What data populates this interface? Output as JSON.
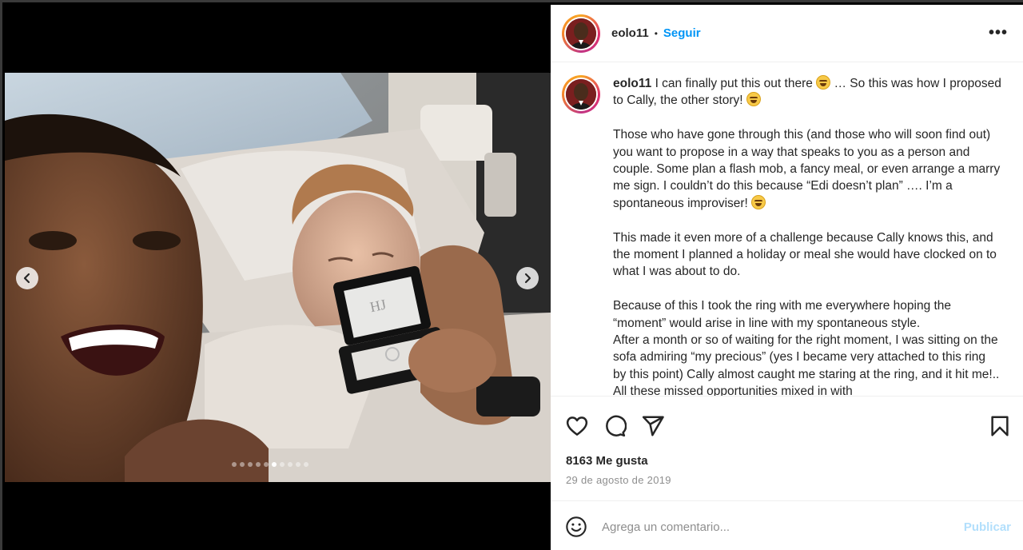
{
  "post": {
    "username": "eolo11",
    "follow_label": "Seguir",
    "more_label": "•••",
    "carousel": {
      "total_slides": 10,
      "active_slide_index": 5
    }
  },
  "caption": {
    "username": "eolo11",
    "p1a": "I can finally put this out there",
    "p1b": "… So this was how I proposed to Cally, the other story!",
    "p2": "Those who have gone through this (and those who will soon find out) you want to propose in a way that speaks to you as a person and couple. Some plan a flash mob, a fancy meal, or even arrange a marry me sign. I couldn’t do this because “Edi doesn’t plan” …. I’m a spontaneous improviser!",
    "p3": "This made it even more of a challenge because Cally knows this, and the moment I planned a holiday or meal she would have clocked on to what I was about to do.",
    "p4a": "Because of this I took the ring with me everywhere hoping the “moment” would arise in line with my spontaneous style.",
    "p4b": "After a month or so of waiting for the right moment, I was sitting on the sofa admiring “my precious” (yes I became very attached to this ring by this point) Cally almost caught me staring at the ring, and it hit me!.. All these missed opportunities mixed in with"
  },
  "stats": {
    "likes": "8163 Me gusta",
    "date": "29 de agosto de 2019"
  },
  "comment": {
    "placeholder": "Agrega un comentario...",
    "publish_label": "Publicar"
  },
  "colors": {
    "link": "#0095f6",
    "publish_disabled": "#b2dffc",
    "muted": "#8e8e8e",
    "text": "#262626"
  },
  "icons": [
    "chevron-left-icon",
    "chevron-right-icon",
    "heart-icon",
    "comment-icon",
    "share-icon",
    "bookmark-icon",
    "emoji-icon",
    "more-icon"
  ]
}
